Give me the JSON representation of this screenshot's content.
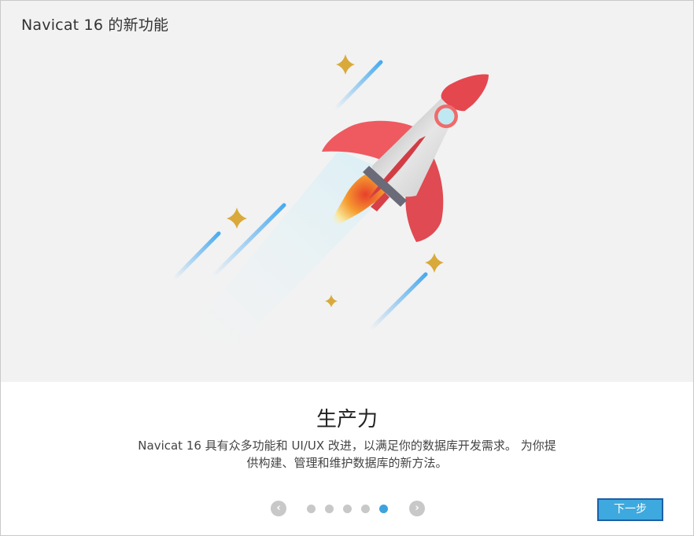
{
  "window": {
    "title": "Navicat 16 的新功能"
  },
  "content": {
    "heading": "生产力",
    "description_line1": "Navicat 16 具有众多功能和 UI/UX 改进，以满足你的数据库开发需求。 为你提",
    "description_line2": "供构建、管理和维护数据库的新方法。"
  },
  "pager": {
    "prev_icon": "chevron-left-icon",
    "next_icon": "chevron-right-icon",
    "pages": 5,
    "current": 5
  },
  "footer": {
    "next_label": "下一步"
  },
  "colors": {
    "hero_bg": "#f2f2f2",
    "rocket_red": "#e34a51",
    "rocket_body": "#d4d4d4",
    "window_ring": "#ef6b6b",
    "window_glass": "#bfe9f2",
    "star_gold": "#d9a93a",
    "streak_blue": "#5ab2ec",
    "accent_blue": "#3ea2dc",
    "button_border": "#1d5fa7"
  }
}
